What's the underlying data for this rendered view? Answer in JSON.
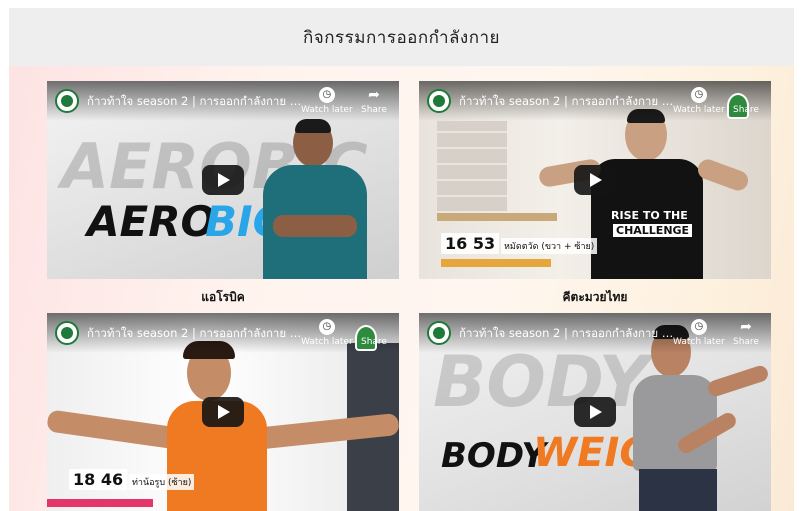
{
  "page": {
    "title": "กิจกรรมการออกกำลังกาย"
  },
  "videos": [
    {
      "title": "ก้าวท้าใจ season 2 | การออกกำลังกาย แบ...",
      "caption": "แอโรบิค",
      "watch_later": "Watch later",
      "share": "Share",
      "art_text_a": "AERO",
      "art_text_b": "BIC",
      "bg_text": "AEROBIC"
    },
    {
      "title": "ก้าวท้าใจ season 2 | การออกกำลังกาย แบ...",
      "caption": "คีตะมวยไทย",
      "watch_later": "Watch later",
      "share": "Share",
      "timer": "16 53",
      "timer_label": "หมัดตวัด (ขวา + ซ้าย)",
      "shirt_line1": "RISE TO THE",
      "shirt_line2": "CHALLENGE"
    },
    {
      "title": "ก้าวท้าใจ season 2 | การออกกำลังกาย แบ...",
      "caption": "",
      "watch_later": "Watch later",
      "share": "Share",
      "timer": "18 46",
      "timer_label": "ท่าน้อรูบ (ซ้าย)"
    },
    {
      "title": "ก้าวท้าใจ season 2 | การออกกำลังกาย แบ...",
      "caption": "",
      "watch_later": "Watch later",
      "share": "Share",
      "art_text_a": "BODY",
      "art_text_b": "WEIGHT",
      "bg_text": "BODY"
    }
  ],
  "colors": {
    "accent_blue": "#2aa5e8",
    "accent_orange": "#f07a22",
    "channel_green": "#1f7a3a",
    "header_bg": "#eeeeee"
  },
  "icons": {
    "watch_later": "clock-icon",
    "share": "share-arrow-icon",
    "play": "play-button-icon",
    "channel": "channel-logo-icon"
  }
}
